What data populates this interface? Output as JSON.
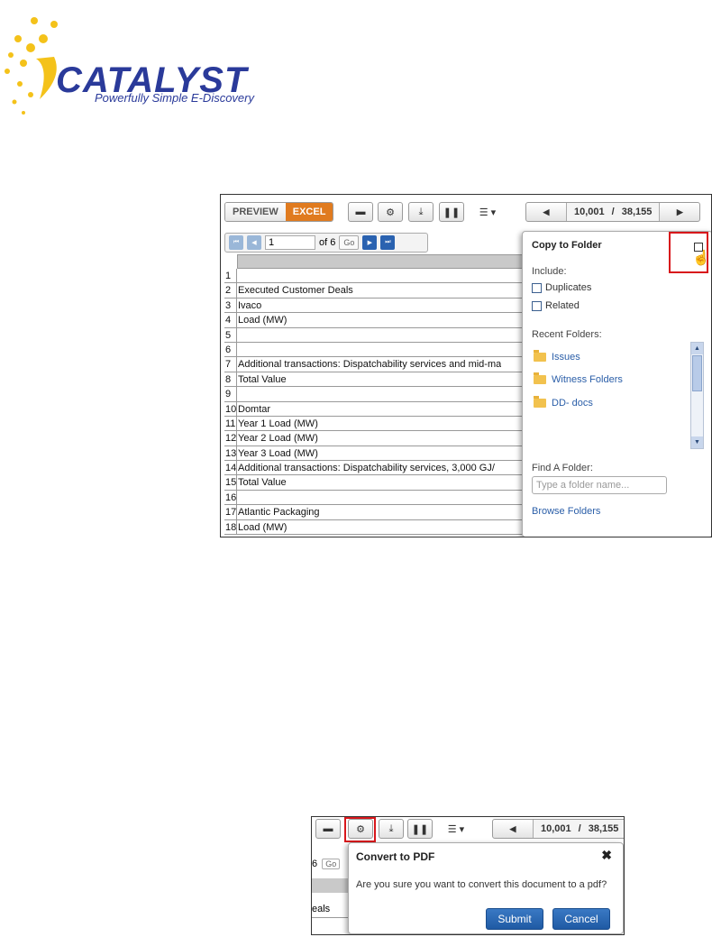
{
  "logo": {
    "wordmark": "CATALYST",
    "tagline": "Powerfully Simple E-Discovery"
  },
  "viewer": {
    "tabs": [
      "PREVIEW",
      "EXCEL"
    ],
    "active_tab": "EXCEL",
    "record_current": "10,001",
    "record_sep": "/",
    "record_total": "38,155"
  },
  "pager": {
    "page_value": "1",
    "of_label": "of 6",
    "go_label": "Go"
  },
  "grid": {
    "rows": [
      {
        "n": "1",
        "text": ""
      },
      {
        "n": "2",
        "text": "Executed Customer Deals"
      },
      {
        "n": "3",
        "text": "Ivaco"
      },
      {
        "n": "4",
        "text": "Load (MW)"
      },
      {
        "n": "5",
        "text": ""
      },
      {
        "n": "6",
        "text": ""
      },
      {
        "n": "7",
        "text": "Additional transactions:  Dispatchability services and mid-ma"
      },
      {
        "n": "8",
        "text": "Total Value"
      },
      {
        "n": "9",
        "text": ""
      },
      {
        "n": "10",
        "text": "Domtar"
      },
      {
        "n": "11",
        "text": "Year 1 Load (MW)"
      },
      {
        "n": "12",
        "text": "Year 2 Load (MW)"
      },
      {
        "n": "13",
        "text": "Year 3 Load (MW)"
      },
      {
        "n": "14",
        "text": "Additional transactions:  Dispatchability services, 3,000 GJ/"
      },
      {
        "n": "15",
        "text": "Total Value"
      },
      {
        "n": "16",
        "text": ""
      },
      {
        "n": "17",
        "text": "Atlantic Packaging"
      },
      {
        "n": "18",
        "text": "Load (MW)"
      }
    ]
  },
  "copy_panel": {
    "title": "Copy to Folder",
    "include_label": "Include:",
    "duplicates_label": "Duplicates",
    "related_label": "Related",
    "recent_label": "Recent Folders:",
    "folders": [
      "Issues",
      "Witness Folders",
      "DD- docs"
    ],
    "find_label": "Find A Folder:",
    "find_placeholder": "Type a folder name...",
    "browse_label": "Browse Folders"
  },
  "convert_dialog": {
    "strip_text": "6",
    "strip_go": "Go",
    "strip_cell": "eals",
    "title": "Convert to PDF",
    "close_glyph": "✖",
    "message": "Are you sure you want to convert this document to a pdf?",
    "submit_label": "Submit",
    "cancel_label": "Cancel"
  }
}
